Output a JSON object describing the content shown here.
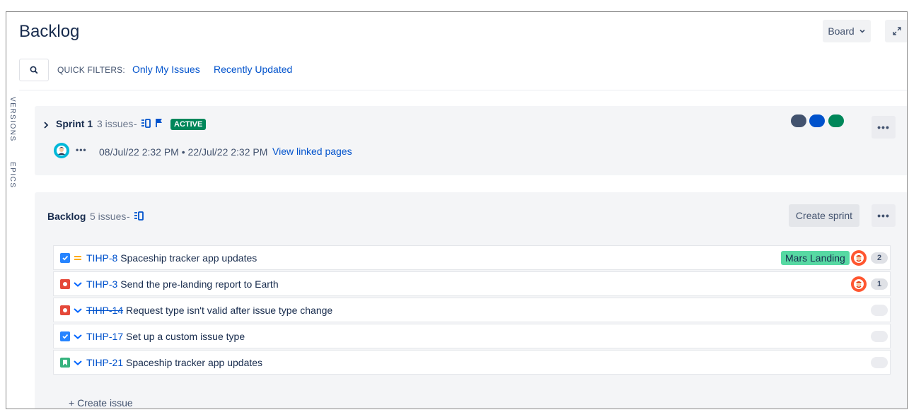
{
  "header": {
    "title": "Backlog",
    "board_label": "Board",
    "expand_icon": "expand-icon"
  },
  "filters": {
    "search_icon": "search-icon",
    "label": "QUICK FILTERS:",
    "items": [
      "Only My Issues",
      "Recently Updated"
    ]
  },
  "side_tabs": [
    "VERSIONS",
    "EPICS"
  ],
  "sprint": {
    "name": "Sprint 1",
    "issue_count": "3 issues",
    "separator": "-",
    "badge": "ACTIVE",
    "date_range": "08/Jul/22 2:32 PM • 22/Jul/22 2:32 PM",
    "link": "View linked pages",
    "more": "•••",
    "status_colors": [
      "#42526e",
      "#0052cc",
      "#00875a"
    ]
  },
  "backlog": {
    "name": "Backlog",
    "issue_count": "5 issues",
    "separator": "-",
    "create_sprint": "Create sprint",
    "more": "•••",
    "issues": [
      {
        "type": "task",
        "priority": "medium",
        "key": "TIHP-8",
        "done": false,
        "summary": "Spaceship tracker app updates",
        "epic": "Mars Landing",
        "assignee": true,
        "estimate": "2"
      },
      {
        "type": "bug",
        "priority": "low",
        "key": "TIHP-3",
        "done": false,
        "summary": "Send the pre-landing report to Earth",
        "epic": "",
        "assignee": true,
        "estimate": "1"
      },
      {
        "type": "bug",
        "priority": "low",
        "key": "TIHP-14",
        "done": true,
        "summary": "Request type isn't valid after issue type change",
        "epic": "",
        "assignee": false,
        "estimate": ""
      },
      {
        "type": "task",
        "priority": "low",
        "key": "TIHP-17",
        "done": false,
        "summary": "Set up a custom issue type",
        "epic": "",
        "assignee": false,
        "estimate": ""
      },
      {
        "type": "story",
        "priority": "low",
        "key": "TIHP-21",
        "done": false,
        "summary": "Spaceship tracker app updates",
        "epic": "",
        "assignee": false,
        "estimate": ""
      }
    ],
    "create_issue": "+ Create issue"
  },
  "colors": {
    "task": "#2684ff",
    "bug": "#e5493a",
    "story": "#36b37e",
    "medium_priority": "#ffab00",
    "low_priority": "#0065ff",
    "link": "#0052cc"
  }
}
